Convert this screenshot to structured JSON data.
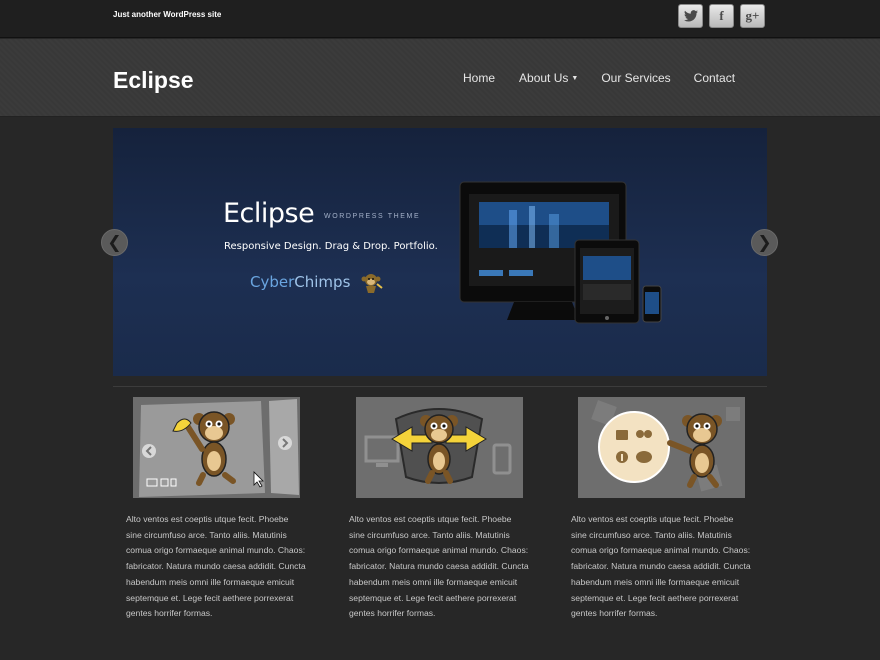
{
  "topbar": {
    "tagline": "Just another WordPress site",
    "social": [
      {
        "icon": "twitter-icon",
        "glyph": "🐦"
      },
      {
        "icon": "facebook-icon",
        "glyph": "f"
      },
      {
        "icon": "google-plus-icon",
        "glyph": "g+"
      }
    ]
  },
  "header": {
    "logo": "Eclipse",
    "nav": [
      {
        "label": "Home"
      },
      {
        "label": "About Us",
        "has_dropdown": true
      },
      {
        "label": "Our Services"
      },
      {
        "label": "Contact"
      }
    ]
  },
  "slider": {
    "title": "Eclipse",
    "subtitle": "WORDPRESS THEME",
    "tagline": "Responsive Design. Drag & Drop. Portfolio.",
    "brand_part1": "Cyber",
    "brand_part2": "Chimps",
    "prev_glyph": "❮",
    "next_glyph": "❯"
  },
  "features": [
    {
      "text": "Alto ventos est coeptis utque fecit. Phoebe sine circumfuso arce. Tanto aliis. Matutinis comua origo formaeque animal mundo. Chaos: fabricator. Natura mundo caesa addidit. Cuncta habendum meis omni ille formaeque emicuit septemque et. Lege fecit aethere porrexerat gentes horrifer formas."
    },
    {
      "text": "Alto ventos est coeptis utque fecit. Phoebe sine circumfuso arce. Tanto aliis. Matutinis comua origo formaeque animal mundo. Chaos: fabricator. Natura mundo caesa addidit. Cuncta habendum meis omni ille formaeque emicuit septemque et. Lege fecit aethere porrexerat gentes horrifer formas."
    },
    {
      "text": "Alto ventos est coeptis utque fecit. Phoebe sine circumfuso arce. Tanto aliis. Matutinis comua origo formaeque animal mundo. Chaos: fabricator. Natura mundo caesa addidit. Cuncta habendum meis omni ille formaeque emicuit septemque et. Lege fecit aethere porrexerat gentes horrifer formas."
    }
  ],
  "colors": {
    "page_bg": "#272727",
    "slider_bg": "#1d2f52",
    "feature_img_bg": "#6e6e6e"
  }
}
